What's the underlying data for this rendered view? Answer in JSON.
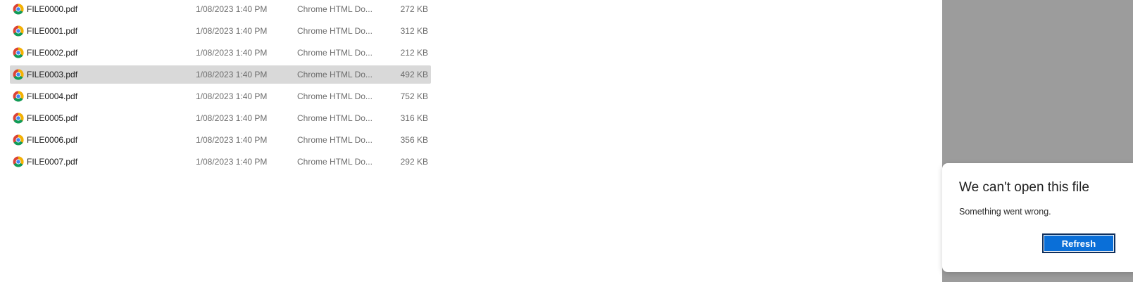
{
  "files": [
    {
      "name": "FILE0000.pdf",
      "date": "1/08/2023 1:40 PM",
      "type": "Chrome HTML Do...",
      "size": "272 KB",
      "selected": false
    },
    {
      "name": "FILE0001.pdf",
      "date": "1/08/2023 1:40 PM",
      "type": "Chrome HTML Do...",
      "size": "312 KB",
      "selected": false
    },
    {
      "name": "FILE0002.pdf",
      "date": "1/08/2023 1:40 PM",
      "type": "Chrome HTML Do...",
      "size": "212 KB",
      "selected": false
    },
    {
      "name": "FILE0003.pdf",
      "date": "1/08/2023 1:40 PM",
      "type": "Chrome HTML Do...",
      "size": "492 KB",
      "selected": true
    },
    {
      "name": "FILE0004.pdf",
      "date": "1/08/2023 1:40 PM",
      "type": "Chrome HTML Do...",
      "size": "752 KB",
      "selected": false
    },
    {
      "name": "FILE0005.pdf",
      "date": "1/08/2023 1:40 PM",
      "type": "Chrome HTML Do...",
      "size": "316 KB",
      "selected": false
    },
    {
      "name": "FILE0006.pdf",
      "date": "1/08/2023 1:40 PM",
      "type": "Chrome HTML Do...",
      "size": "356 KB",
      "selected": false
    },
    {
      "name": "FILE0007.pdf",
      "date": "1/08/2023 1:40 PM",
      "type": "Chrome HTML Do...",
      "size": "292 KB",
      "selected": false
    }
  ],
  "file_icon": "chrome-icon",
  "error_dialog": {
    "title": "We can't open this file",
    "message": "Something went wrong.",
    "button_label": "Refresh"
  },
  "colors": {
    "selected_row": "#d9d9d9",
    "preview_pane": "#9c9c9c",
    "accent_button": "#0a6fd8"
  }
}
